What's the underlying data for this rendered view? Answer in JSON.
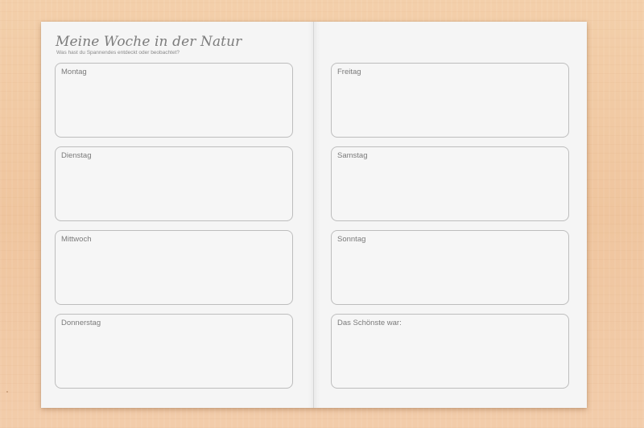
{
  "worksheet": {
    "title": "Meine Woche in der Natur",
    "subtitle": "Was hast du Spannendes entdeckt oder beobachtet?",
    "left_page": {
      "boxes": [
        {
          "label": "Montag"
        },
        {
          "label": "Dienstag"
        },
        {
          "label": "Mittwoch"
        },
        {
          "label": "Donnerstag"
        }
      ]
    },
    "right_page": {
      "boxes": [
        {
          "label": "Freitag"
        },
        {
          "label": "Samstag"
        },
        {
          "label": "Sonntag"
        },
        {
          "label": "Das Schönste war:"
        }
      ]
    }
  },
  "colors": {
    "background": "#f0c9a4",
    "paper": "#f5f5f5",
    "box_border": "#bdbdbd",
    "text": "#7a7a7a"
  }
}
